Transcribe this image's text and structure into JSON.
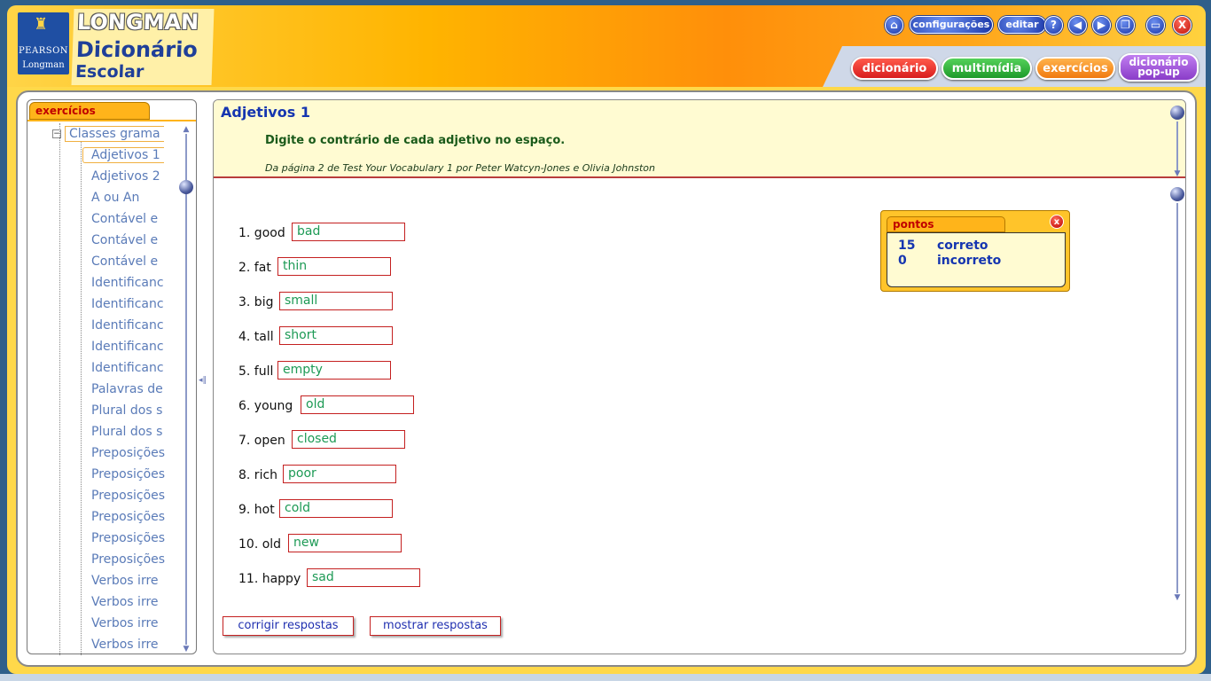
{
  "header": {
    "publisher_top": "PEARSON",
    "publisher_bottom": "Longman",
    "brand_name": "LONGMAN",
    "product_line1": "Dicionário",
    "product_line2": "Escolar",
    "toolbar": {
      "home_icon": "⌂",
      "settings_label": "configurações",
      "edit_label": "editar",
      "help_label": "?",
      "back_icon": "◀",
      "forward_icon": "▶",
      "restore_icon": "❐",
      "maximize_icon": "▭",
      "close_label": "X"
    },
    "nav": {
      "dictionary": "dicionário",
      "multimedia": "multimídia",
      "exercises": "exercícios",
      "popup_line1": "dicionário",
      "popup_line2": "pop-up",
      "colors": {
        "dictionary": "#d81e1e",
        "multimedia": "#1e9a2a",
        "exercises": "#f07a10",
        "popup": "#8a3cc8"
      }
    }
  },
  "sidebar": {
    "tab_label": "exercícios",
    "root": "Classes grama",
    "items": [
      "Adjetivos 1",
      "Adjetivos 2",
      "A ou An",
      "Contável e",
      "Contável e",
      "Contável e",
      "Identificanc",
      "Identificanc",
      "Identificanc",
      "Identificanc",
      "Identificanc",
      "Palavras de",
      "Plural dos s",
      "Plural dos s",
      "Preposições",
      "Preposições",
      "Preposições",
      "Preposições",
      "Preposições",
      "Preposições",
      "Verbos irre",
      "Verbos irre",
      "Verbos irre",
      "Verbos irre"
    ],
    "selected_index": 0
  },
  "exercise": {
    "title": "Adjetivos 1",
    "instruction": "Digite o contrário de cada adjetivo no espaço.",
    "source": "Da página 2 de Test Your Vocabulary 1 por Peter Watcyn-Jones e Olivia Johnston",
    "questions": [
      {
        "label": "1. good",
        "answer": "bad"
      },
      {
        "label": "2. fat",
        "answer": "thin"
      },
      {
        "label": "3. big",
        "answer": "small"
      },
      {
        "label": "4. tall",
        "answer": "short"
      },
      {
        "label": "5. full",
        "answer": "empty"
      },
      {
        "label": "6. young",
        "answer": "old"
      },
      {
        "label": "7. open",
        "answer": "closed"
      },
      {
        "label": "8. rich",
        "answer": "poor"
      },
      {
        "label": "9. hot",
        "answer": "cold"
      },
      {
        "label": "10. old",
        "answer": "new"
      },
      {
        "label": "11. happy",
        "answer": "sad"
      }
    ],
    "check_button": "corrigir respostas",
    "show_button": "mostrar respostas"
  },
  "score": {
    "tab_label": "pontos",
    "close_label": "x",
    "correct_count": "15",
    "correct_label": "correto",
    "incorrect_count": "0",
    "incorrect_label": "incorreto"
  }
}
